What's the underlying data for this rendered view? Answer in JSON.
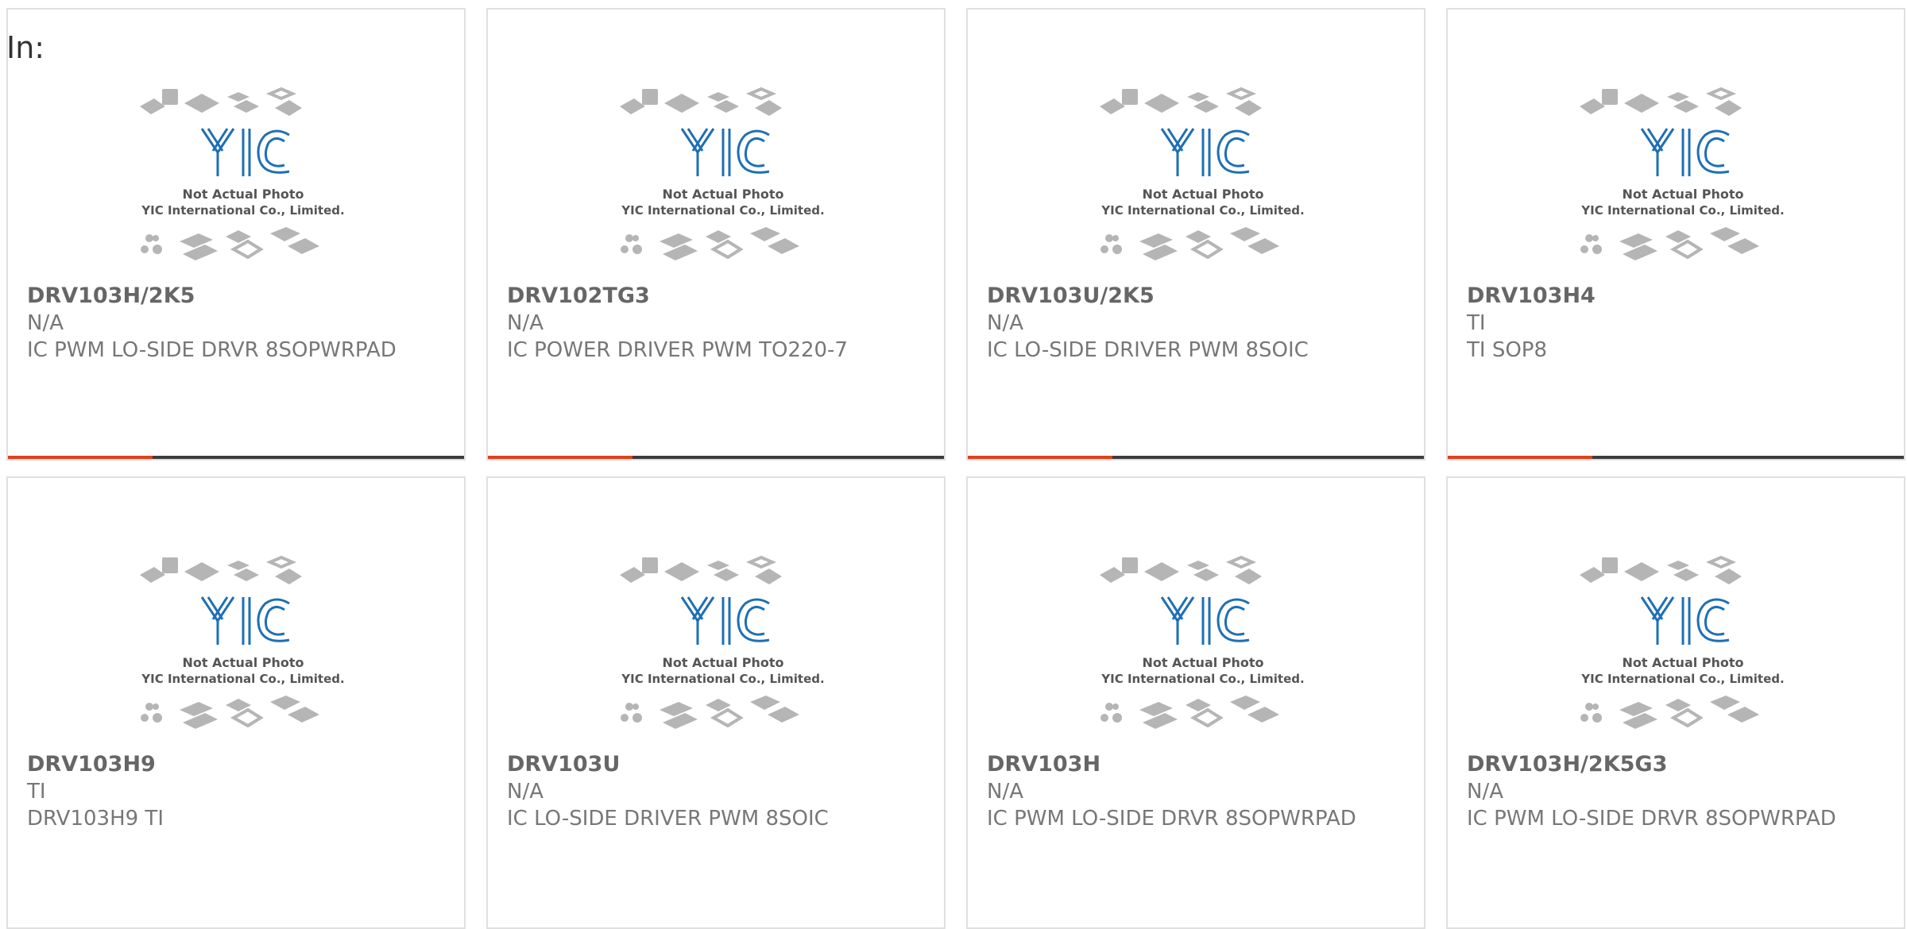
{
  "header": {
    "label": "In:"
  },
  "products": [
    {
      "part_number": "DRV103H/2K5",
      "manufacturer": "N/A",
      "description": "IC PWM LO-SIDE DRVR 8SOPWRPAD"
    },
    {
      "part_number": "DRV102TG3",
      "manufacturer": "N/A",
      "description": "IC POWER DRIVER PWM TO220-7"
    },
    {
      "part_number": "DRV103U/2K5",
      "manufacturer": "N/A",
      "description": "IC LO-SIDE DRIVER PWM 8SOIC"
    },
    {
      "part_number": "DRV103H4",
      "manufacturer": "TI",
      "description": "TI SOP8"
    },
    {
      "part_number": "DRV103H9",
      "manufacturer": "TI",
      "description": "DRV103H9 TI"
    },
    {
      "part_number": "DRV103U",
      "manufacturer": "N/A",
      "description": "IC LO-SIDE DRIVER PWM 8SOIC"
    },
    {
      "part_number": "DRV103H",
      "manufacturer": "N/A",
      "description": "IC PWM LO-SIDE DRVR 8SOPWRPAD"
    },
    {
      "part_number": "DRV103H/2K5G3",
      "manufacturer": "N/A",
      "description": "IC PWM LO-SIDE DRVR 8SOPWRPAD"
    }
  ],
  "placeholder_image": {
    "logo_text": "YIC",
    "line1": "Not Actual Photo",
    "line2": "YIC International Co., Limited."
  },
  "colors": {
    "accent": "#e0401c",
    "bar": "#3c3c3c",
    "logo": "#1e6fb5"
  }
}
